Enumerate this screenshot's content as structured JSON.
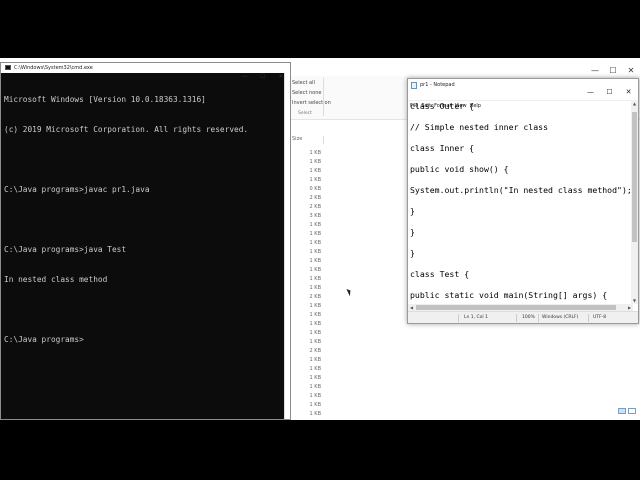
{
  "explorer": {
    "ribbon_items": [
      "Select all",
      "Select none",
      "Invert selection"
    ],
    "ribbon_group": "Select",
    "size_header": "Size",
    "file_sizes": [
      "1 KB",
      "1 KB",
      "1 KB",
      "1 KB",
      "0 KB",
      "2 KB",
      "2 KB",
      "3 KB",
      "1 KB",
      "1 KB",
      "1 KB",
      "1 KB",
      "1 KB",
      "1 KB",
      "1 KB",
      "1 KB",
      "2 KB",
      "1 KB",
      "1 KB",
      "1 KB",
      "1 KB",
      "1 KB",
      "2 KB",
      "1 KB",
      "1 KB",
      "1 KB",
      "1 KB",
      "1 KB",
      "1 KB",
      "1 KB",
      "1 KB",
      "1 KB",
      "1 KB",
      "1 KB"
    ],
    "window_buttons": {
      "minimize": "—",
      "maximize": "☐",
      "close": "✕"
    }
  },
  "cmd": {
    "title": "C:\\Windows\\System32\\cmd.exe",
    "window_buttons": {
      "minimize": "—",
      "maximize": "☐",
      "close": "✕"
    },
    "lines": [
      "Microsoft Windows [Version 10.0.18363.1316]",
      "(c) 2019 Microsoft Corporation. All rights reserved.",
      "",
      "C:\\Java programs>javac pr1.java",
      "",
      "C:\\Java programs>java Test",
      "In nested class method",
      "",
      "C:\\Java programs>"
    ]
  },
  "notepad": {
    "title": "pr1 - Notepad",
    "window_buttons": {
      "minimize": "—",
      "maximize": "☐",
      "close": "✕"
    },
    "menu": [
      "File",
      "Edit",
      "Format",
      "View",
      "Help"
    ],
    "code_lines": [
      "class Outer {",
      "",
      "// Simple nested inner class",
      "",
      "class Inner {",
      "",
      "public void show() {",
      "",
      "System.out.println(\"In nested class method\");",
      "",
      "}",
      "",
      "}",
      "",
      "}",
      "",
      "class Test {",
      "",
      "public static void main(String[] args) {"
    ],
    "status": {
      "position": "Ln 1, Col 1",
      "zoom": "100%",
      "line_ending": "Windows (CRLF)",
      "encoding": "UTF-8"
    }
  }
}
